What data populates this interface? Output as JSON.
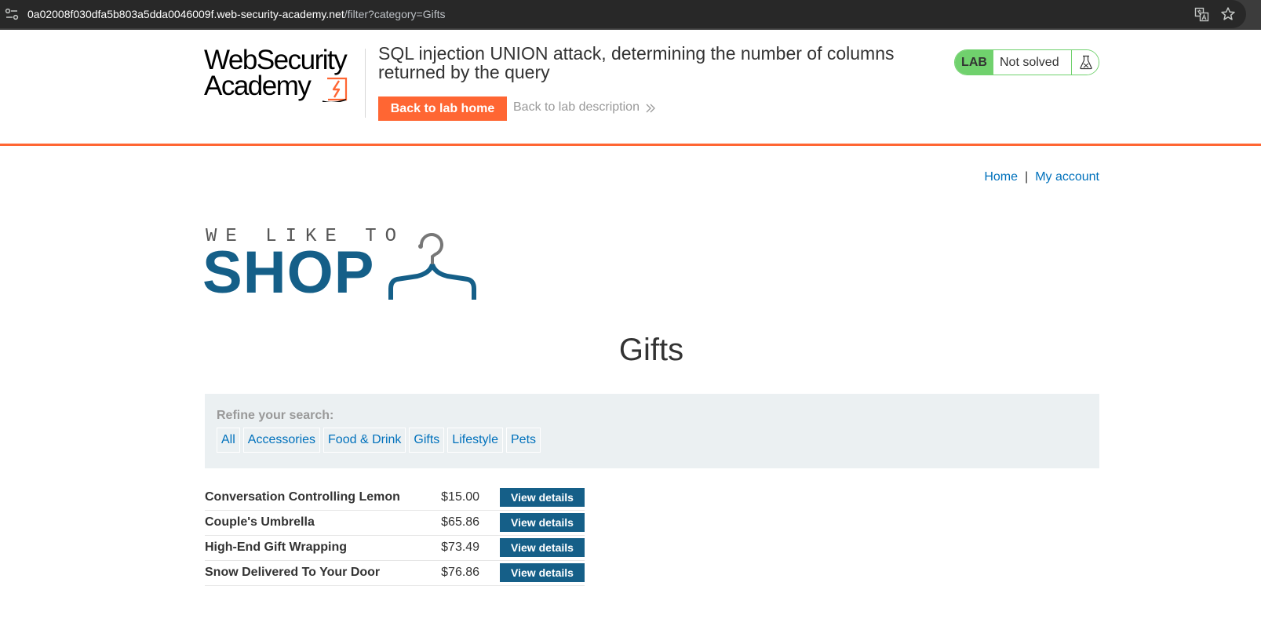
{
  "browser": {
    "url_host": "0a02008f030dfa5b803a5dda0046009f.web-security-academy.net",
    "url_path": "/filter?category=Gifts",
    "icons": [
      "site-info-icon",
      "translate-icon",
      "bookmark-star-icon"
    ]
  },
  "academy": {
    "logo_line1": "WebSecurity",
    "logo_line2": "Academy",
    "lab_title": "SQL injection UNION attack, determining the number of columns returned by the query",
    "back_home_label": "Back to lab home",
    "back_description_label": "Back to lab description",
    "lab_badge": "LAB",
    "lab_status": "Not solved",
    "colors": {
      "accent": "#ff6633",
      "lab_green": "#70d16d"
    }
  },
  "shop": {
    "nav": {
      "home": "Home",
      "separator": "|",
      "my_account": "My account"
    },
    "logo_tagline": "WE LIKE TO",
    "logo_word": "SHOP",
    "category_title": "Gifts",
    "filter": {
      "label": "Refine your search:",
      "categories": [
        "All",
        "Accessories",
        "Food & Drink",
        "Gifts",
        "Lifestyle",
        "Pets"
      ]
    },
    "products": [
      {
        "name": "Conversation Controlling Lemon",
        "price": "$15.00",
        "action": "View details"
      },
      {
        "name": "Couple's Umbrella",
        "price": "$65.86",
        "action": "View details"
      },
      {
        "name": "High-End Gift Wrapping",
        "price": "$73.49",
        "action": "View details"
      },
      {
        "name": "Snow Delivered To Your Door",
        "price": "$76.86",
        "action": "View details"
      }
    ],
    "colors": {
      "link": "#0071bc",
      "brand_blue": "#155f88",
      "panel": "#ebf0f2"
    }
  }
}
